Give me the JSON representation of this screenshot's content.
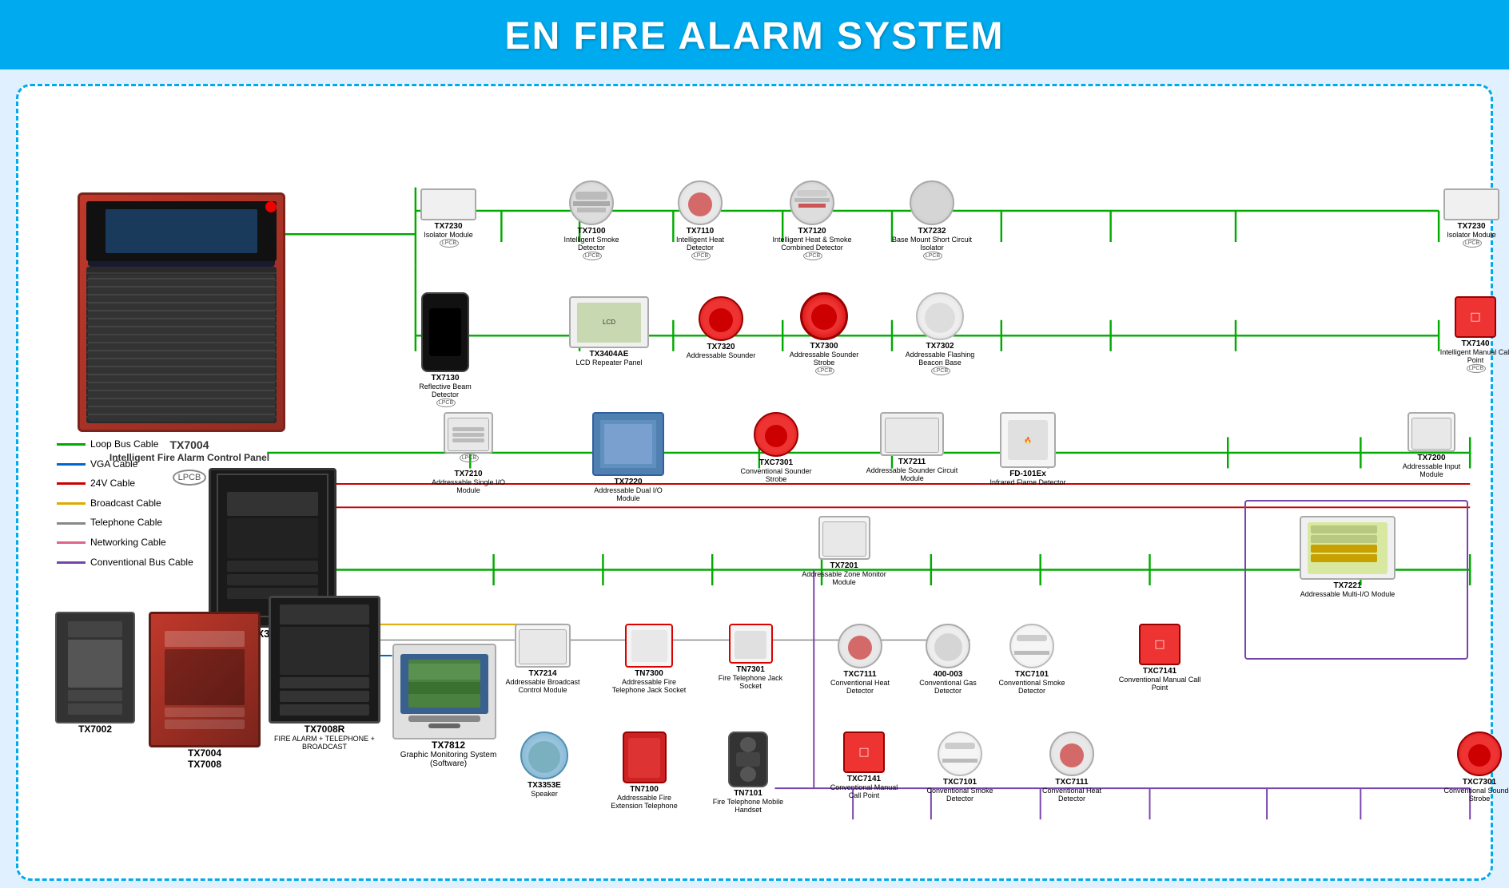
{
  "page": {
    "title": "EN FIRE ALARM SYSTEM"
  },
  "legend": {
    "items": [
      {
        "label": "Loop Bus Cable",
        "color": "#00aa00"
      },
      {
        "label": "VGA Cable",
        "color": "#0066cc"
      },
      {
        "label": "24V Cable",
        "color": "#cc0000"
      },
      {
        "label": "Broadcast Cable",
        "color": "#ddaa00"
      },
      {
        "label": "Telephone Cable",
        "color": "#888888"
      },
      {
        "label": "Networking Cable",
        "color": "#dd6688"
      },
      {
        "label": "Conventional Bus Cable",
        "color": "#7744aa"
      }
    ]
  },
  "devices": {
    "main_panel": {
      "model": "TX7004",
      "name": "Intelligent Fire Alarm Control Panel"
    },
    "tx3000d": {
      "model": "TX3000D",
      "name": ""
    },
    "tx7002": {
      "model": "TX7002",
      "name": ""
    },
    "tx7004_7008": {
      "model": "TX7004\nTX7008",
      "name": ""
    },
    "tx7008r": {
      "model": "TX7008R",
      "name": "FIRE ALARM + TELEPHONE + BROADCAST"
    },
    "tx7812": {
      "model": "TX7812",
      "name": "Graphic Monitoring System (Software)"
    },
    "tx7230_1": {
      "model": "TX7230",
      "name": "Isolator Module"
    },
    "tx7100": {
      "model": "TX7100",
      "name": "Intelligent Smoke Detector"
    },
    "tx7110": {
      "model": "TX7110",
      "name": "Intelligent Heat Detector"
    },
    "tx7120": {
      "model": "TX7120",
      "name": "Intelligent Heat & Smoke Combined Detector"
    },
    "tx7232": {
      "model": "TX7232",
      "name": "Base Mount Short Circuit Isolator"
    },
    "tx7230_2": {
      "model": "TX7230",
      "name": "Isolator Module"
    },
    "tx7130": {
      "model": "TX7130",
      "name": "Reflective Beam Detector"
    },
    "tx3404ae": {
      "model": "TX3404AE",
      "name": "LCD Repeater Panel"
    },
    "tx7320": {
      "model": "TX7320",
      "name": "Addressable Sounder"
    },
    "tx7300": {
      "model": "TX7300",
      "name": "Addressable Sounder Strobe"
    },
    "tx7302": {
      "model": "TX7302",
      "name": "Addressable Flashing Beacon Base"
    },
    "tx7140": {
      "model": "TX7140",
      "name": "Intelligent Manual Call Point"
    },
    "tx7210": {
      "model": "TX7210",
      "name": "Addressable Single I/O Module"
    },
    "tx7220": {
      "model": "TX7220",
      "name": "Addressable Dual I/O Module"
    },
    "txc7301_conv": {
      "model": "TXC7301",
      "name": "Conventional Sounder Strobe"
    },
    "tx7211": {
      "model": "TX7211",
      "name": "Addressable Sounder Circuit Module"
    },
    "fd101ex": {
      "model": "FD-101Ex",
      "name": "Infrared Flame Detector"
    },
    "tx7200": {
      "model": "TX7200",
      "name": "Addressable Input Module"
    },
    "tx7201": {
      "model": "TX7201",
      "name": "Addressable Zone Monitor Module"
    },
    "tx7221": {
      "model": "TX7221",
      "name": "Addressable Multi-I/O Module"
    },
    "tx7214": {
      "model": "TX7214",
      "name": "Addressable Broadcast Control Module"
    },
    "tn7300": {
      "model": "TN7300",
      "name": "Addressable Fire Telephone Jack Socket"
    },
    "tn7301": {
      "model": "TN7301",
      "name": "Fire Telephone Jack Socket"
    },
    "txc7111_heat": {
      "model": "TXC7111",
      "name": "Conventional Heat Detector"
    },
    "gas_400003": {
      "model": "400-003",
      "name": "Conventional Gas Detector"
    },
    "txc7101_smoke": {
      "model": "TXC7101",
      "name": "Conventional Smoke Detector"
    },
    "txc7141_mcp": {
      "model": "TXC7141",
      "name": "Conventional Manual Call Point"
    },
    "tx3353e": {
      "model": "TX3353E",
      "name": "Speaker"
    },
    "tn7100": {
      "model": "TN7100",
      "name": "Addressable Fire Extension Telephone"
    },
    "tn7101": {
      "model": "TN7101",
      "name": "Fire Telephone Mobile Handset"
    },
    "txc7141_bottom": {
      "model": "TXC7141",
      "name": "Conventional Manual Call Point"
    },
    "txc7101_bottom": {
      "model": "TXC7101",
      "name": "Conventional Smoke Detector"
    },
    "txc7111_bottom": {
      "model": "TXC7111",
      "name": "Conventional Heat Detector"
    },
    "txc7301_bottom": {
      "model": "TXC7301",
      "name": "Conventional Sounder Strobe"
    }
  }
}
